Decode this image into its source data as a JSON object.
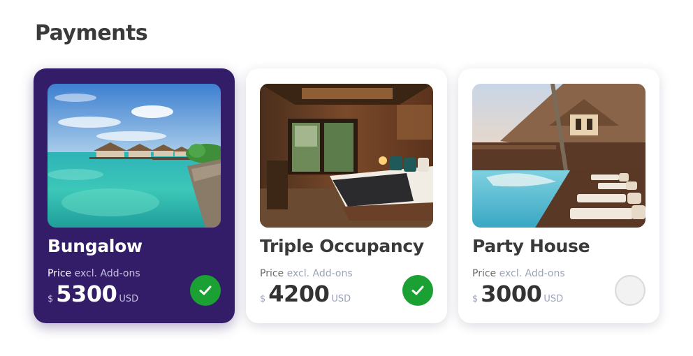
{
  "page": {
    "title": "Payments"
  },
  "colors": {
    "selected_card": "#331d68",
    "check": "#1aa033",
    "text_dark": "#3a3a3a",
    "text_muted": "#9aa2b6"
  },
  "cards": [
    {
      "name": "Bungalow",
      "image": "overwater-bungalow-photo",
      "price_label": "Price",
      "price_note": "excl. Add-ons",
      "currency_symbol": "$",
      "amount": "5300",
      "currency_code": "USD",
      "selected": true,
      "checked": true
    },
    {
      "name": "Triple Occupancy",
      "image": "hotel-bedroom-photo",
      "price_label": "Price",
      "price_note": "excl. Add-ons",
      "currency_symbol": "$",
      "amount": "4200",
      "currency_code": "USD",
      "selected": false,
      "checked": true
    },
    {
      "name": "Party House",
      "image": "pool-villa-photo",
      "price_label": "Price",
      "price_note": "excl. Add-ons",
      "currency_symbol": "$",
      "amount": "3000",
      "currency_code": "USD",
      "selected": false,
      "checked": false
    }
  ]
}
